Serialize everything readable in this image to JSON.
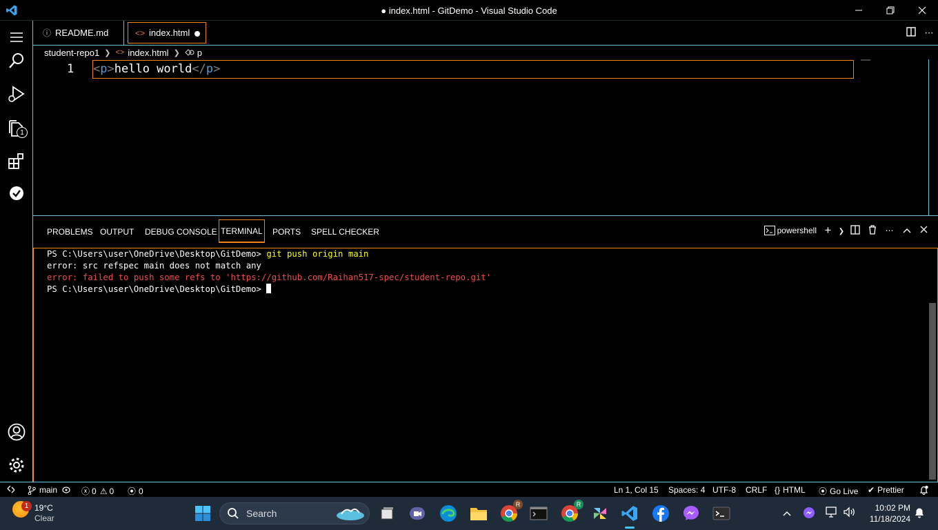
{
  "window": {
    "title": "● index.html - GitDemo - Visual Studio Code"
  },
  "tabs": [
    {
      "label": "README.md",
      "icon": "info-icon"
    },
    {
      "label": "index.html",
      "icon": "code-icon",
      "dirty": true
    }
  ],
  "breadcrumbs": {
    "folder": "student-repo1",
    "file": "index.html",
    "symbol": "p"
  },
  "editor": {
    "line_number": "1",
    "open_tag_lt": "<",
    "open_tag_name": "p",
    "open_tag_gt": ">",
    "text": "hello world",
    "close_tag_lt": "</",
    "close_tag_name": "p",
    "close_tag_gt": ">"
  },
  "activity": {
    "explorer_badge": "1"
  },
  "panel": {
    "tabs": [
      "PROBLEMS",
      "OUTPUT",
      "DEBUG CONSOLE",
      "TERMINAL",
      "PORTS",
      "SPELL CHECKER"
    ],
    "active_tab": "TERMINAL",
    "shell": "powershell"
  },
  "terminal": {
    "prompt": "PS C:\\Users\\user\\OneDrive\\Desktop\\GitDemo> ",
    "command": "git push origin main",
    "line2": "error: src refspec main does not match any",
    "line3": "error: failed to push some refs to 'https://github.com/Raihan517-spec/student-repo.git'"
  },
  "status": {
    "branch": "main",
    "errors": "0",
    "warnings": "0",
    "ports": "0",
    "position": "Ln 1, Col 15",
    "spaces": "Spaces: 4",
    "encoding": "UTF-8",
    "eol": "CRLF",
    "language": "HTML",
    "golive": "Go Live",
    "prettier": "Prettier"
  },
  "taskbar": {
    "weather_badge": "1",
    "temperature": "19°C",
    "condition": "Clear",
    "search_label": "Search",
    "time": "10:02 PM",
    "date": "11/18/2024",
    "chrome_profile_1": "R",
    "chrome_profile_2": "R"
  },
  "colors": {
    "contrast_border": "#6fc3df",
    "focus_border": "#f38518",
    "terminal_error": "#f14c4c",
    "terminal_command": "#ffff00",
    "tag": "#569cd6"
  }
}
